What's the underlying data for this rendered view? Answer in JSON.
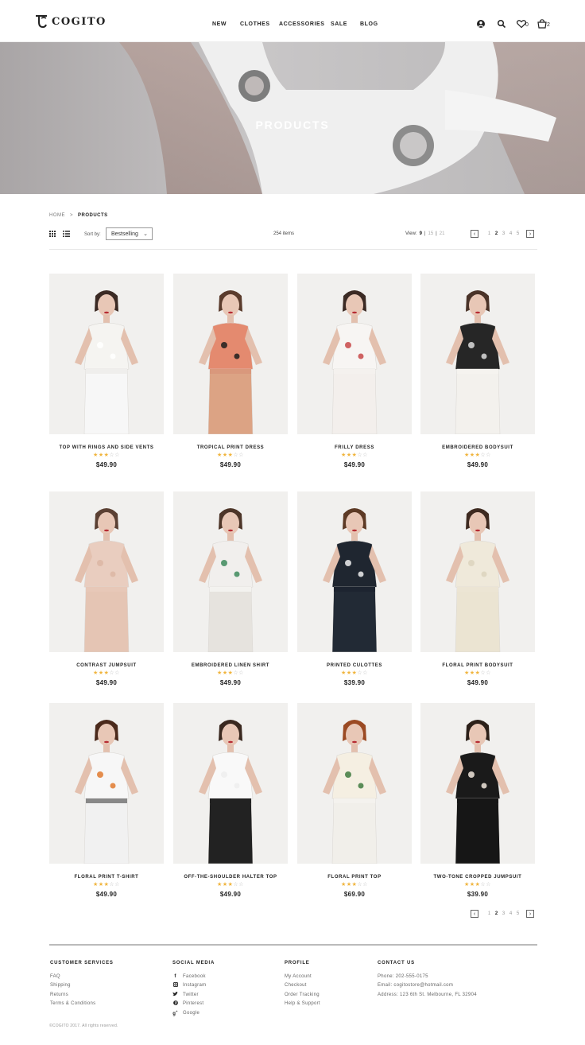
{
  "brand": {
    "name": "COGITO",
    "logo_glyph": "TC"
  },
  "nav": [
    "NEW",
    "CLOTHES",
    "ACCESSORIES",
    "SALE",
    "BLOG"
  ],
  "header_icons": {
    "wishlist_count": "0",
    "cart_count": "2"
  },
  "hero": {
    "title": "PRODUCTS"
  },
  "breadcrumb": {
    "home": "HOME",
    "separator": ">",
    "current": "PRODUCTS"
  },
  "toolbar": {
    "sort_label": "Sort by:",
    "sort_value": "Bestselling",
    "items_count": "254 items",
    "view_label": "View:",
    "view_options": [
      "9",
      "|",
      "15",
      "|",
      "21"
    ],
    "pages": [
      "1",
      "2",
      "3",
      "4",
      "5"
    ],
    "active_page": "2"
  },
  "products": [
    {
      "name": "TOP WITH RINGS AND SIDE VENTS",
      "price": "$49.90",
      "rating": 3,
      "max_rating": 5
    },
    {
      "name": "TROPICAL PRINT DRESS",
      "price": "$49.90",
      "rating": 3,
      "max_rating": 5
    },
    {
      "name": "FRILLY DRESS",
      "price": "$49.90",
      "rating": 3,
      "max_rating": 5
    },
    {
      "name": "EMBROIDERED BODYSUIT",
      "price": "$49.90",
      "rating": 3,
      "max_rating": 5
    },
    {
      "name": "CONTRAST JUMPSUIT",
      "price": "$49.90",
      "rating": 3,
      "max_rating": 5
    },
    {
      "name": "EMBROIDERED LINEN SHIRT",
      "price": "$49.90",
      "rating": 3,
      "max_rating": 5
    },
    {
      "name": "PRINTED CULOTTES",
      "price": "$39.90",
      "rating": 3,
      "max_rating": 5
    },
    {
      "name": "FLORAL PRINT BODYSUIT",
      "price": "$49.90",
      "rating": 3,
      "max_rating": 5
    },
    {
      "name": "FLORAL PRINT T-SHIRT",
      "price": "$49.90",
      "rating": 3,
      "max_rating": 5
    },
    {
      "name": "OFF-THE-SHOULDER HALTER TOP",
      "price": "$49.90",
      "rating": 3,
      "max_rating": 5
    },
    {
      "name": "FLORAL PRINT TOP",
      "price": "$69.90",
      "rating": 3,
      "max_rating": 5
    },
    {
      "name": "TWO-TONE CROPPED JUMPSUIT",
      "price": "$39.90",
      "rating": 3,
      "max_rating": 5
    }
  ],
  "footer": {
    "customer_services": {
      "title": "CUSTOMER SERVICES",
      "items": [
        "FAQ",
        "Shipping",
        "Returns",
        "Terms & Conditions"
      ]
    },
    "social_media": {
      "title": "SOCIAL MEDIA",
      "items": [
        {
          "label": "Facebook",
          "icon": "facebook-icon"
        },
        {
          "label": "Instagram",
          "icon": "instagram-icon"
        },
        {
          "label": "Twitter",
          "icon": "twitter-icon"
        },
        {
          "label": "Pinterest",
          "icon": "pinterest-icon"
        },
        {
          "label": "Google",
          "icon": "google-plus-icon"
        }
      ]
    },
    "profile": {
      "title": "PROFILE",
      "items": [
        "My Account",
        "Checkout",
        "Order Tracking",
        "Help & Support"
      ]
    },
    "contact": {
      "title": "CONTACT US",
      "items": [
        "Phone: 202-555-0175",
        "Email: cogitostore@hotmail.com",
        "Address: 123 6th St. Melbourne, FL 32904"
      ]
    },
    "copyright": "©COGITO 2017. All rights reserved."
  },
  "colors": {
    "star_on": "#f0b43c",
    "star_off": "#bbbbbb",
    "text": "#222222"
  }
}
